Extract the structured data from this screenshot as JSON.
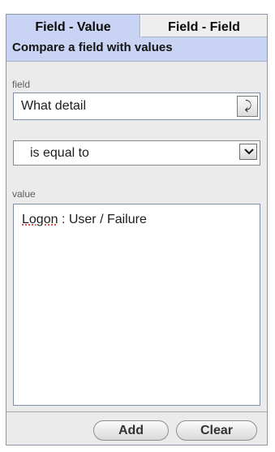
{
  "tabs": [
    {
      "label": "Field - Value",
      "active": true
    },
    {
      "label": "Field - Field",
      "active": false
    }
  ],
  "description": "Compare a field with values",
  "field": {
    "label": "field",
    "value": "What detail",
    "picker_icon": "field-picker-icon"
  },
  "operator": {
    "selected": "is equal to",
    "dropdown_icon": "chevron-down-icon"
  },
  "value_area": {
    "label": "value",
    "entries": [
      {
        "term": "Logon",
        "rest": " : User / Failure"
      }
    ]
  },
  "buttons": {
    "add": "Add",
    "clear": "Clear"
  },
  "colors": {
    "tab_active_bg": "#c9d3f3",
    "panel_bg": "#ebebeb",
    "border": "#8c98aa"
  }
}
